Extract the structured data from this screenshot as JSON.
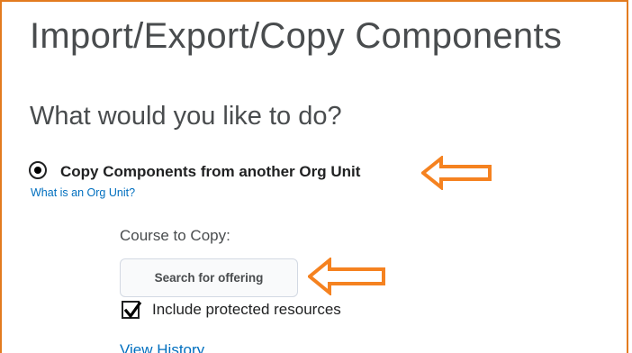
{
  "page": {
    "title": "Import/Export/Copy Components",
    "question": "What would you like to do?"
  },
  "option": {
    "label": "Copy Components from another Org Unit",
    "selected": true,
    "help_link": "What is an Org Unit?"
  },
  "course": {
    "label": "Course to Copy:",
    "search_button": "Search for offering",
    "include_protected_label": "Include protected resources",
    "include_protected_checked": true,
    "view_history": "View History"
  },
  "annotations": {
    "arrow_color": "#f58220",
    "arrows": [
      "arrow-left-icon",
      "arrow-left-icon"
    ]
  },
  "colors": {
    "frame": "#e37b1f",
    "link": "#006fbf",
    "heading": "#494c4e"
  }
}
